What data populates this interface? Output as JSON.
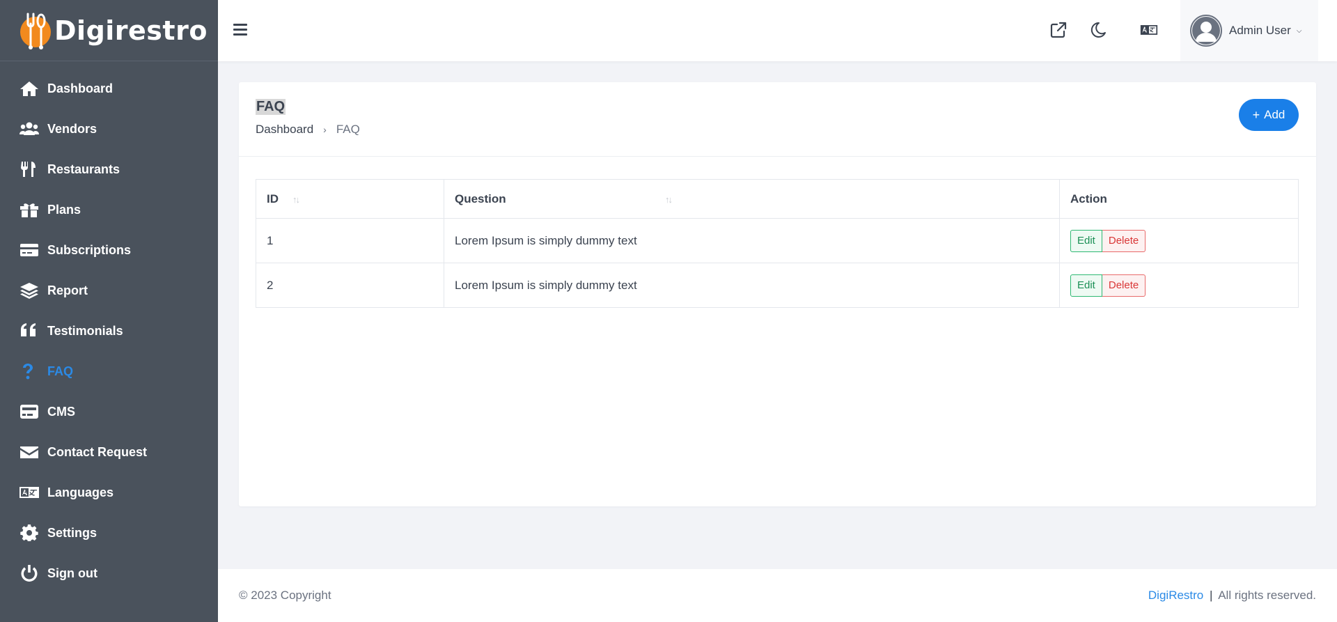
{
  "brand": {
    "name": "Digirestro"
  },
  "sidebar": {
    "items": [
      {
        "label": "Dashboard",
        "icon": "home-icon"
      },
      {
        "label": "Vendors",
        "icon": "users-icon"
      },
      {
        "label": "Restaurants",
        "icon": "utensils-icon"
      },
      {
        "label": "Plans",
        "icon": "gift-icon"
      },
      {
        "label": "Subscriptions",
        "icon": "credit-card-icon"
      },
      {
        "label": "Report",
        "icon": "layers-icon"
      },
      {
        "label": "Testimonials",
        "icon": "quote-icon"
      },
      {
        "label": "FAQ",
        "icon": "question-icon",
        "active": true
      },
      {
        "label": "CMS",
        "icon": "cms-card-icon"
      },
      {
        "label": "Contact Request",
        "icon": "envelope-icon"
      },
      {
        "label": "Languages",
        "icon": "language-icon"
      },
      {
        "label": "Settings",
        "icon": "gear-icon"
      },
      {
        "label": "Sign out",
        "icon": "power-icon"
      }
    ]
  },
  "header": {
    "user_name": "Admin User",
    "icons": [
      "external-link-icon",
      "moon-icon",
      "language-icon"
    ]
  },
  "page": {
    "title": "FAQ",
    "breadcrumb": {
      "home": "Dashboard",
      "separator": "›",
      "current": "FAQ"
    },
    "add_button": {
      "plus": "+",
      "label": "Add"
    }
  },
  "table": {
    "headers": {
      "id": "ID",
      "question": "Question",
      "action": "Action"
    },
    "sort_glyph": "↑↓",
    "rows": [
      {
        "id": "1",
        "question": "Lorem Ipsum is simply dummy text",
        "edit": "Edit",
        "delete": "Delete"
      },
      {
        "id": "2",
        "question": "Lorem Ipsum is simply dummy text",
        "edit": "Edit",
        "delete": "Delete"
      }
    ]
  },
  "footer": {
    "copyright": "© 2023 Copyright",
    "brand_link": "DigiRestro",
    "separator": "|",
    "rights": "All rights reserved."
  },
  "colors": {
    "sidebar_bg": "#4a525c",
    "accent": "#1a7fe8",
    "active_nav": "#2b8ae6",
    "logo_orange": "#f28a1e"
  }
}
